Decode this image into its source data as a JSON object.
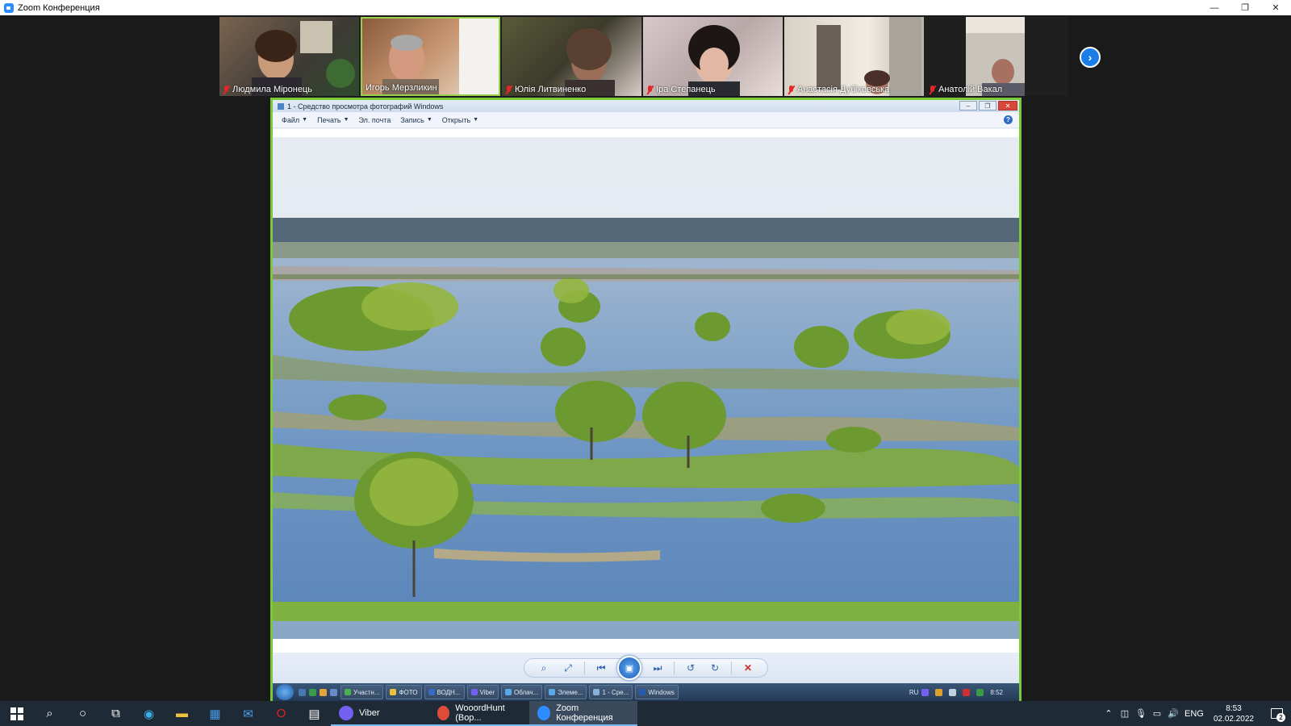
{
  "window": {
    "title": "Zoom Конференция",
    "minimize_icon": "minimize-icon",
    "restore_icon": "restore-icon",
    "close_icon": "close-icon"
  },
  "participants": [
    {
      "name": "Людмила Міронець",
      "muted": true
    },
    {
      "name": "Игорь Мерзликин",
      "muted": false
    },
    {
      "name": "Юлія Литвиненко",
      "muted": true
    },
    {
      "name": "Іра Степанець",
      "muted": true
    },
    {
      "name": "Анастасія Дубіковська",
      "muted": true
    },
    {
      "name": "Анатолій Вакал",
      "muted": true
    }
  ],
  "shared_screen": {
    "title": "1 - Средство просмотра фотографий Windows",
    "menu": [
      "Файл",
      "Печать",
      "Эл. почта",
      "Запись",
      "Открыть"
    ],
    "photo_description_icon": "landscape-photo",
    "inner_taskbar": {
      "tasks": [
        "Участн...",
        "ФОТО",
        "ВОДН...",
        "Viber",
        "Облач...",
        "Элеме...",
        "1 - Сре...",
        "Windows"
      ],
      "lang": "RU",
      "time": "8:52"
    }
  },
  "taskbar": {
    "apps": [
      {
        "label": "Viber",
        "color": "#7360f2"
      },
      {
        "label": "WooordHunt (Вор...",
        "color": "#dd4b39"
      },
      {
        "label": "Zoom Конференция",
        "color": "#2d8cff"
      }
    ],
    "lang": "ENG",
    "time": "8:53",
    "date": "02.02.2022",
    "notifications": "2"
  },
  "colors": {
    "accent_border": "#7bc93a",
    "zoom_blue": "#2d8cff"
  }
}
